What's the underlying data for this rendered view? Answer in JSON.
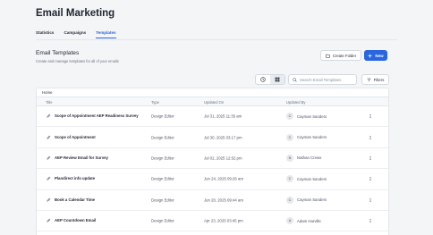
{
  "app": {
    "title": "Email Marketing"
  },
  "tabs": [
    {
      "label": "Statistics",
      "active": false
    },
    {
      "label": "Campaigns",
      "active": false
    },
    {
      "label": "Templates",
      "active": true
    }
  ],
  "section": {
    "title": "Email Templates",
    "subtitle": "Create and manage templates for all of your emails"
  },
  "actions": {
    "create_folder": "Create Folder",
    "new": "New"
  },
  "toolbar": {
    "search_placeholder": "Search Email Templates",
    "filters_label": "Filters",
    "view_selected": "grid"
  },
  "breadcrumb": "Home",
  "columns": {
    "title": "Title",
    "type": "Type",
    "updated_on": "Updated On",
    "updated_by": "Updated By"
  },
  "rows": [
    {
      "title": "Scope of Appointment AEP Readiness Survey",
      "type": "Design Editor",
      "updated_on": "Jul 31, 2025 11:35 am",
      "initial": "C",
      "updated_by": "Cayman Sanders"
    },
    {
      "title": "Scope of Appointment",
      "type": "Design Editor",
      "updated_on": "Jul 30, 2025 03:17 pm",
      "initial": "C",
      "updated_by": "Cayman Sanders"
    },
    {
      "title": "AEP Review Email for Survey",
      "type": "Design Editor",
      "updated_on": "Jul 02, 2025 12:52 pm",
      "initial": "N",
      "updated_by": "Nathan Crews"
    },
    {
      "title": "Plandirect info update",
      "type": "Design Editor",
      "updated_on": "Jun 24, 2025 09:26 am",
      "initial": "C",
      "updated_by": "Cayman Sanders"
    },
    {
      "title": "Book a Calendar Time",
      "type": "Design Editor",
      "updated_on": "Jun 20, 2025 09:44 am",
      "initial": "C",
      "updated_by": "Cayman Sanders"
    },
    {
      "title": "AEP Countdown Email",
      "type": "Design Editor",
      "updated_on": "Apr 23, 2025 03:45 pm",
      "initial": "A",
      "updated_by": "Adam Harville"
    }
  ],
  "colors": {
    "accent": "#2a66e0",
    "background": "#f4f5f7"
  }
}
